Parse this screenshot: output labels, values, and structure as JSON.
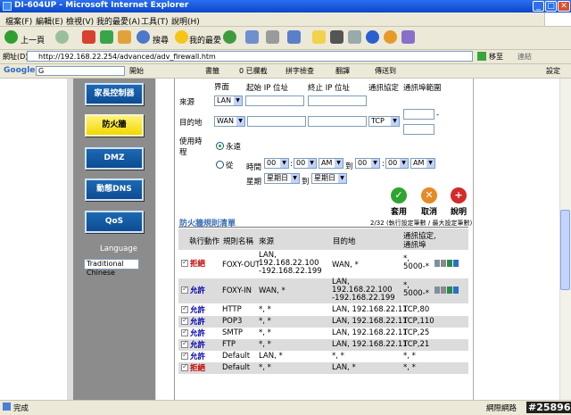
{
  "window": {
    "title": "DI-604UP - Microsoft Internet Explorer",
    "btn_min": "_",
    "btn_max": "□",
    "btn_close": "✕"
  },
  "menu": [
    "檔案(F)",
    "編輯(E)",
    "檢視(V)",
    "我的最愛(A)",
    "工具(T)",
    "說明(H)"
  ],
  "toolbar": {
    "back": "上一頁",
    "search": "搜尋",
    "favorites": "我的最愛"
  },
  "address": {
    "label": "網址(D)",
    "url": "http://192.168.22.254/advanced/adv_firewall.htm",
    "go": "移至",
    "links": "連結"
  },
  "googlebar": {
    "brand": "Google",
    "search_box": "G",
    "open": "開始",
    "bookmarks": "書籤",
    "blocked": "0 已攔截",
    "spell": "拼字檢查",
    "translate": "翻譯",
    "send_to": "傳送到",
    "settings": "設定"
  },
  "nav": {
    "admin": "家長控制器",
    "firewall": "防火牆",
    "dmz": "DMZ",
    "ddns": "動態DNS",
    "qos": "QoS",
    "language_label": "Language",
    "language_value": "Traditional Chinese"
  },
  "form": {
    "col_interface": "界面",
    "col_start_ip": "起始 IP 位址",
    "col_end_ip": "終止 IP 位址",
    "col_protocol": "通訊協定",
    "col_port_range": "通訊埠範圍",
    "source_label": "來源",
    "source_iface": "LAN",
    "dest_label": "目的地",
    "dest_iface": "WAN",
    "dest_protocol": "TCP",
    "schedule_label1": "使用時",
    "schedule_label2": "程",
    "always": "永遠",
    "from": "從",
    "time": "時間",
    "to": "到",
    "start_hour": "00",
    "start_min": "00",
    "start_ampm": "AM",
    "end_hour": "00",
    "end_min": "00",
    "end_ampm": "AM",
    "weekday": "星期",
    "weekday_start": "星期日",
    "weekday_end": "星期日",
    "dash": "-"
  },
  "actions": {
    "apply": "套用",
    "cancel": "取消",
    "help": "說明"
  },
  "rules": {
    "title": "防火牆規則清單",
    "count": "2/32 (執行設定筆數 / 最大設定筆數)",
    "headers": {
      "action": "執行動作",
      "name": "規則名稱",
      "source": "來源",
      "dest": "目的地",
      "proto1": "通訊協定,",
      "proto2": "通訊埠"
    },
    "rows": [
      {
        "action": "拒絕",
        "type": "deny",
        "name": "FOXY-OUT",
        "source": "LAN, 192.168.22.100 -192.168.22.199",
        "dest": "WAN, *",
        "proto": "*, 5000-*"
      },
      {
        "action": "允許",
        "type": "allow",
        "name": "FOXY-IN",
        "source": "WAN, *",
        "dest": "LAN, 192.168.22.100 -192.168.22.199",
        "proto": "*, 5000-*"
      },
      {
        "action": "允許",
        "type": "allow",
        "name": "HTTP",
        "source": "*, *",
        "dest": "LAN, 192.168.22.11",
        "proto": "TCP,80"
      },
      {
        "action": "允許",
        "type": "allow",
        "name": "POP3",
        "source": "*, *",
        "dest": "LAN, 192.168.22.11",
        "proto": "TCP,110"
      },
      {
        "action": "允許",
        "type": "allow",
        "name": "SMTP",
        "source": "*, *",
        "dest": "LAN, 192.168.22.11",
        "proto": "TCP,25"
      },
      {
        "action": "允許",
        "type": "allow",
        "name": "FTP",
        "source": "*, *",
        "dest": "LAN, 192.168.22.11",
        "proto": "TCP,21"
      },
      {
        "action": "允許",
        "type": "allow",
        "name": "Default",
        "source": "LAN, *",
        "dest": "*, *",
        "proto": "*, *"
      },
      {
        "action": "拒絕",
        "type": "deny",
        "name": "Default",
        "source": "*, *",
        "dest": "LAN, *",
        "proto": "*, *"
      }
    ]
  },
  "status": {
    "left": "完成",
    "zone": "網際網路"
  },
  "watermark": "#258965"
}
